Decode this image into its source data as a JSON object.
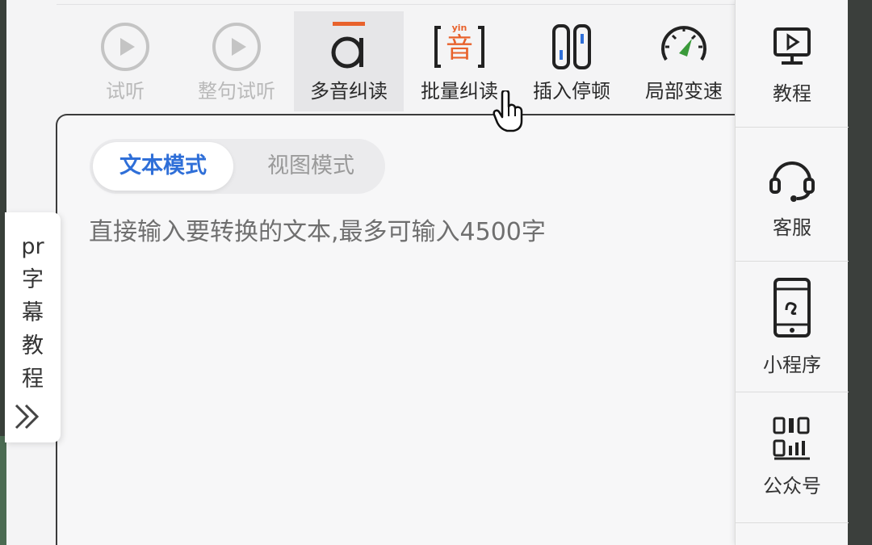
{
  "toolbar": {
    "items": [
      {
        "label": "试听",
        "icon": "play-circle-icon",
        "state": "disabled"
      },
      {
        "label": "整句试听",
        "icon": "play-circle-icon",
        "state": "disabled"
      },
      {
        "label": "多音纠读",
        "icon": "pronunciation-a-icon",
        "state": "active"
      },
      {
        "label": "批量纠读",
        "icon": "pinyin-yin-icon",
        "icon_text": "音",
        "icon_sup": "yin",
        "state": "normal"
      },
      {
        "label": "插入停顿",
        "icon": "pause-bars-icon",
        "state": "normal"
      },
      {
        "label": "局部变速",
        "icon": "speedometer-icon",
        "state": "normal"
      }
    ]
  },
  "editor": {
    "modes": [
      {
        "label": "文本模式",
        "active": true
      },
      {
        "label": "视图模式",
        "active": false
      }
    ],
    "placeholder": "直接输入要转换的文本,最多可输入4500字"
  },
  "pr_tab": {
    "chars": [
      "pr",
      "字",
      "幕",
      "教",
      "程"
    ]
  },
  "sidebar": {
    "items": [
      {
        "label": "教程",
        "icon": "video-tutorial-icon"
      },
      {
        "label": "客服",
        "icon": "headset-icon"
      },
      {
        "label": "小程序",
        "icon": "mini-program-phone-icon"
      },
      {
        "label": "公众号",
        "icon": "official-account-icon"
      }
    ]
  },
  "colors": {
    "accent_blue": "#2f6fd8",
    "icon_orange": "#e8622c",
    "speed_green": "#3a9a3a"
  }
}
